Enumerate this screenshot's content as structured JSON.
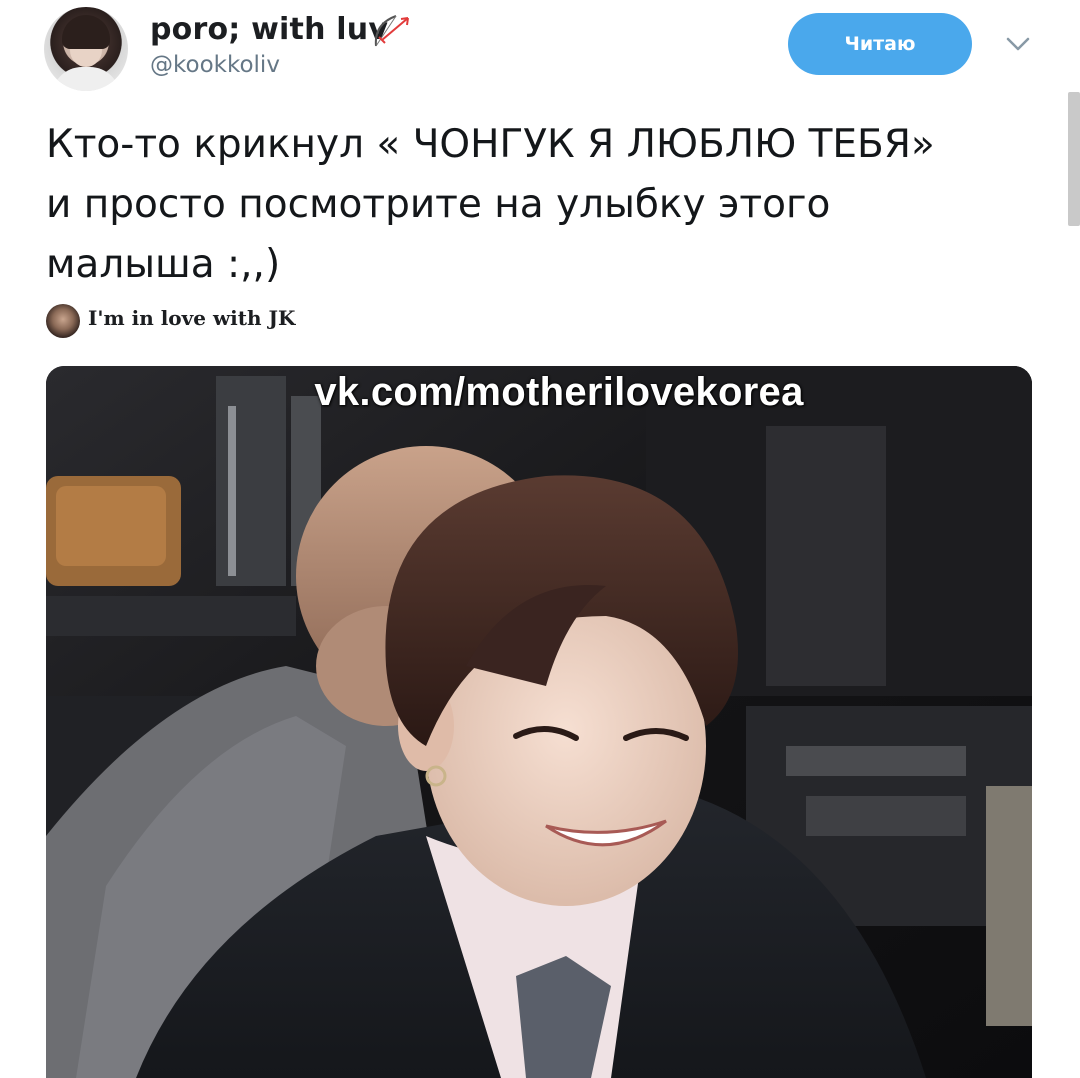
{
  "user": {
    "display_name": "poro; with luv",
    "handle": "@kookkoliv"
  },
  "follow_button": {
    "label": "Читаю",
    "color": "#4aa8ec"
  },
  "tweet": {
    "lines": [
      "Кто-то крикнул « ЧОНГУК Я ЛЮБЛЮ ТЕБЯ»",
      "и просто посмотрите на улыбку этого",
      "малыша :,,)"
    ]
  },
  "attribution": {
    "text": "I'm in love with JK"
  },
  "media": {
    "watermark": "vk.com/motherilovekorea"
  },
  "icons": {
    "name_icon": "bow-and-arrow-icon",
    "menu_icon": "chevron-down-icon"
  }
}
